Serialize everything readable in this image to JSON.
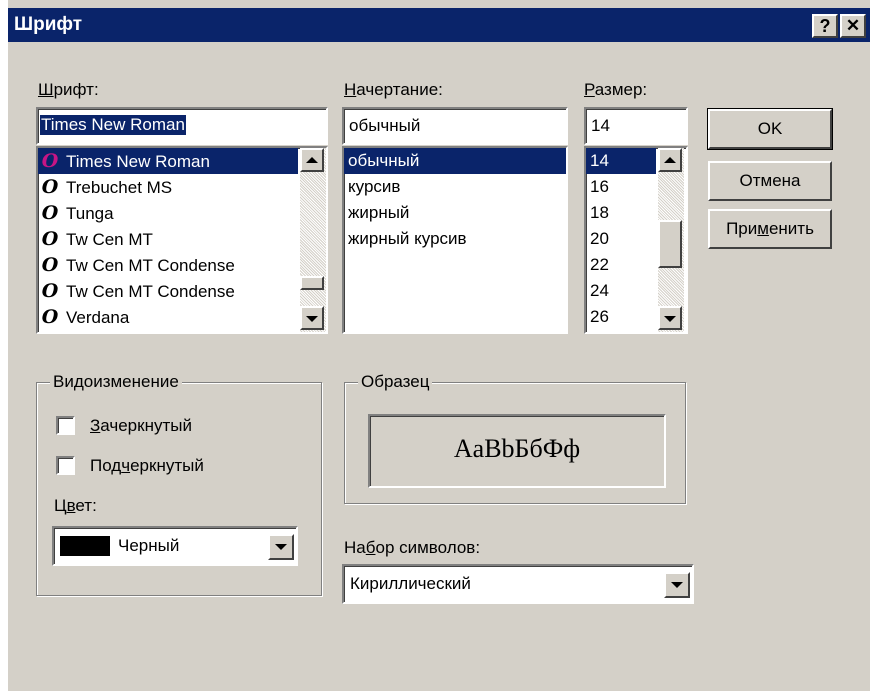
{
  "window": {
    "title": "Шрифт",
    "help_button": "?",
    "close_button": "✕"
  },
  "font": {
    "label_key": "Ш",
    "label_rest": "рифт:",
    "value": "Times New Roman",
    "items": [
      {
        "name": "Times New Roman",
        "icon": "opentype-font-icon",
        "color": "#c71585"
      },
      {
        "name": "Trebuchet MS",
        "icon": "opentype-font-icon",
        "color": "#000000"
      },
      {
        "name": "Tunga",
        "icon": "opentype-font-icon",
        "color": "#000000"
      },
      {
        "name": "Tw Cen MT",
        "icon": "opentype-font-icon",
        "color": "#000000"
      },
      {
        "name": "Tw Cen MT Condense",
        "icon": "opentype-font-icon",
        "color": "#000000"
      },
      {
        "name": "Tw Cen MT Condense",
        "icon": "opentype-font-icon",
        "color": "#000000"
      },
      {
        "name": "Verdana",
        "icon": "opentype-font-icon",
        "color": "#000000"
      }
    ],
    "selected_index": 0
  },
  "style": {
    "label_key": "Н",
    "label_rest": "ачертание:",
    "value": "обычный",
    "items": [
      "обычный",
      "курсив",
      "жирный",
      "жирный курсив"
    ],
    "selected_index": 0
  },
  "size": {
    "label_key": "Р",
    "label_rest": "азмер:",
    "value": "14",
    "items": [
      "14",
      "16",
      "18",
      "20",
      "22",
      "24",
      "26"
    ],
    "selected_index": 0
  },
  "buttons": {
    "ok": "OK",
    "cancel": "Отмена",
    "apply_pre": "При",
    "apply_key": "м",
    "apply_post": "енить"
  },
  "effects": {
    "title": "Видоизменение",
    "strike_key": "З",
    "strike_rest": "ачеркнутый",
    "strike_checked": false,
    "underline_pre": "Под",
    "underline_key": "ч",
    "underline_post": "еркнутый",
    "underline_checked": false,
    "color_label_pre": "Ц",
    "color_label_key": "в",
    "color_label_post": "ет:",
    "color_value": "Черный",
    "color_swatch": "#000000"
  },
  "sample": {
    "title": "Образец",
    "text": "AaBbБбФф"
  },
  "charset": {
    "label_pre": "На",
    "label_key": "б",
    "label_post": "ор символов:",
    "value": "Кириллический"
  },
  "colors": {
    "title_bar": "#0a246a",
    "dialog_face": "#d4d0c8",
    "selection": "#0a246a"
  }
}
